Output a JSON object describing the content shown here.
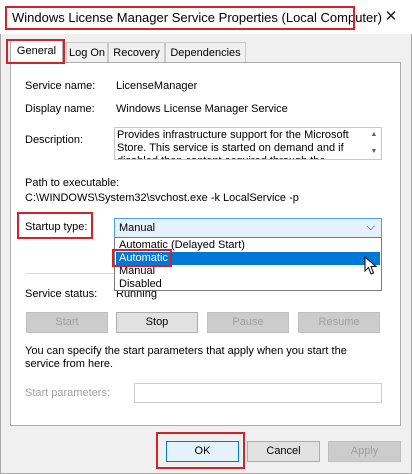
{
  "window": {
    "title": "Windows License Manager Service Properties (Local Computer)",
    "close_glyph": "✕"
  },
  "tabs": [
    {
      "label": "General",
      "active": true
    },
    {
      "label": "Log On",
      "active": false
    },
    {
      "label": "Recovery",
      "active": false
    },
    {
      "label": "Dependencies",
      "active": false
    }
  ],
  "general": {
    "service_name_label": "Service name:",
    "service_name": "LicenseManager",
    "display_name_label": "Display name:",
    "display_name": "Windows License Manager Service",
    "description_label": "Description:",
    "description": "Provides infrastructure support for the Microsoft Store.  This service is started on demand and if disabled then content acquired through the",
    "path_label": "Path to executable:",
    "path": "C:\\WINDOWS\\System32\\svchost.exe -k LocalService -p",
    "startup_type_label": "Startup type:",
    "startup_type_value": "Manual",
    "startup_options": [
      "Automatic (Delayed Start)",
      "Automatic",
      "Manual",
      "Disabled"
    ],
    "startup_selected_option": "Automatic",
    "service_status_label": "Service status:",
    "service_status": "Running",
    "buttons": {
      "start": "Start",
      "stop": "Stop",
      "pause": "Pause",
      "resume": "Resume"
    },
    "start_params_note": "You can specify the start parameters that apply when you start the service from here.",
    "start_params_label": "Start parameters:",
    "start_params_value": ""
  },
  "footer": {
    "ok": "OK",
    "cancel": "Cancel",
    "apply": "Apply"
  },
  "colors": {
    "highlight": "#0078d7",
    "annotation_red": "#d2232a"
  }
}
